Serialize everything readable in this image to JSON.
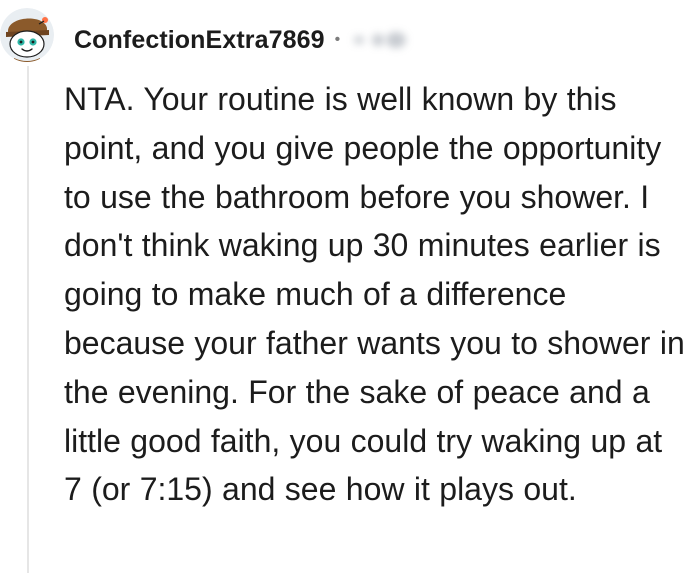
{
  "comment": {
    "username": "ConfectionExtra7869",
    "separator": "•",
    "timestamp_visible": false,
    "body": "NTA. Your routine is well known by this point, and you give people the opportunity to use the bathroom before you shower. I don't think waking up 30 minutes earlier is going to make much of a difference because your father wants you to shower in the evening. For the sake of peace and a little good faith, you could try waking up at 7 (or 7:15) and see how it plays out."
  },
  "avatar": {
    "icon": "snoo-avatar-icon",
    "colors": {
      "background": "#e9eef2",
      "face": "#ffffff",
      "hat": "#8b5a2b",
      "accent": "#2fb7a7"
    }
  },
  "colors": {
    "text": "#1c1c1c",
    "muted": "#7c7c7c",
    "thread_line": "#e6e6e6"
  }
}
